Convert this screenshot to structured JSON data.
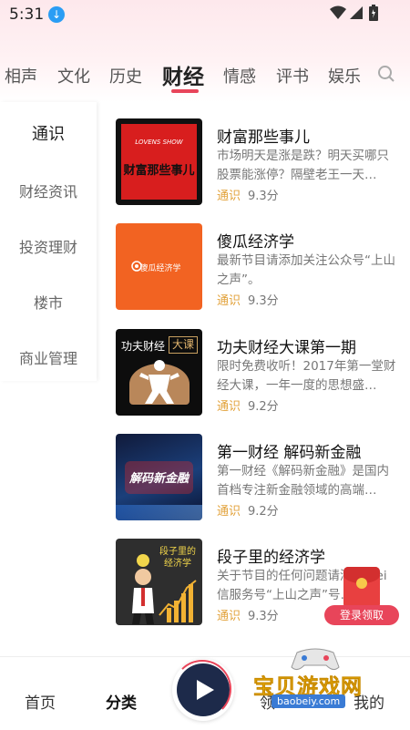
{
  "status_bar": {
    "time": "5:31",
    "download_icon": "download-icon",
    "icons": [
      "wifi-icon",
      "cell-signal-icon",
      "battery-icon"
    ]
  },
  "tabs": [
    {
      "label": "相声",
      "active": false
    },
    {
      "label": "文化",
      "active": false
    },
    {
      "label": "历史",
      "active": false
    },
    {
      "label": "财经",
      "active": true
    },
    {
      "label": "情感",
      "active": false
    },
    {
      "label": "评书",
      "active": false
    },
    {
      "label": "娱乐",
      "active": false
    }
  ],
  "sidebar": {
    "items": [
      {
        "label": "通识",
        "active": true
      },
      {
        "label": "财经资讯",
        "active": false
      },
      {
        "label": "投资理财",
        "active": false
      },
      {
        "label": "楼市",
        "active": false
      },
      {
        "label": "商业管理",
        "active": false
      }
    ]
  },
  "list": [
    {
      "title": "财富那些事儿",
      "desc": "市场明天是涨是跌？明天买哪只股票能涨停？隔壁老王一天…",
      "tag": "通识",
      "score": "9.3分",
      "thumb_text": "财富那些事儿",
      "thumb_sub": "LOVENS SHOW"
    },
    {
      "title": "傻瓜经济学",
      "desc": "最新节目请添加关注公众号“上山之声”。",
      "tag": "通识",
      "score": "9.3分",
      "thumb_text": "傻瓜经济学"
    },
    {
      "title": "功夫财经大课第一期",
      "desc": "限时免费收听！2017年第一堂财经大课，一年一度的思想盛…",
      "tag": "通识",
      "score": "9.2分",
      "thumb_text": "功夫财经",
      "thumb_text2": "大课"
    },
    {
      "title": "第一财经 解码新金融",
      "desc": "第一财经《解码新金融》是国内首档专注新金融领域的高端…",
      "tag": "通识",
      "score": "9.2分",
      "thumb_text": "解码新金融"
    },
    {
      "title": "段子里的经济学",
      "desc": "关于节目的任何问题请添加Wei信服务号“上山之声”号…",
      "tag": "通识",
      "score": "9.3分",
      "thumb_text": "段子里的经济学"
    }
  ],
  "promo": {
    "label": "登录领取"
  },
  "bottom_nav": {
    "items": [
      {
        "label": "首页",
        "active": false
      },
      {
        "label": "分类",
        "active": true
      },
      {
        "label": "领",
        "active": false
      },
      {
        "label": "我的",
        "active": false
      }
    ]
  },
  "watermark": {
    "text": "宝贝游戏网",
    "url": "baobeiy.com"
  },
  "colors": {
    "accent": "#e8455a",
    "tag": "#e2a23b"
  }
}
